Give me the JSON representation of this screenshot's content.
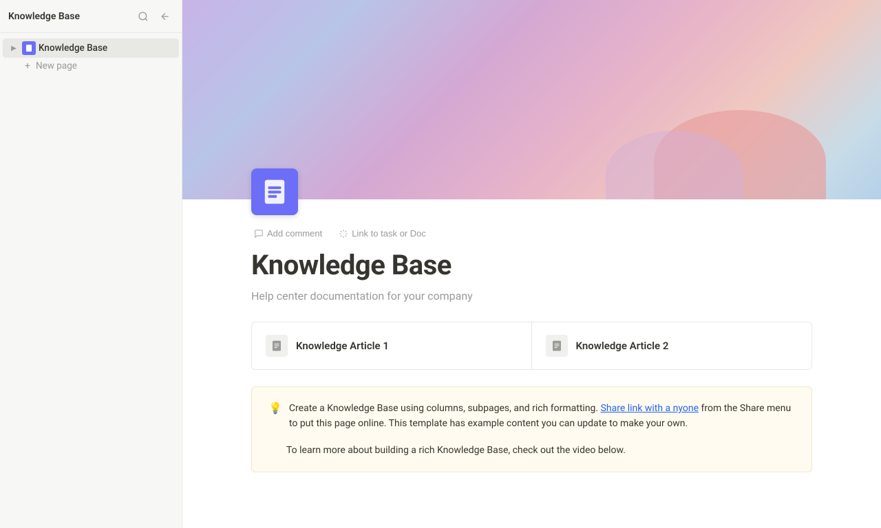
{
  "sidebar": {
    "title": "Knowledge Base",
    "search_tooltip": "Search",
    "collapse_tooltip": "Collapse sidebar",
    "nav_items": [
      {
        "id": "knowledge-base",
        "label": "Knowledge Base",
        "active": true
      }
    ],
    "new_page_label": "New page"
  },
  "hero": {
    "alt": "Colorful gradient banner"
  },
  "page": {
    "icon_alt": "Document icon",
    "toolbar": {
      "add_comment": "Add comment",
      "link_to_task": "Link to task or Doc"
    },
    "title": "Knowledge Base",
    "description": "Help center documentation for your company"
  },
  "articles": [
    {
      "label": "Knowledge Article 1"
    },
    {
      "label": "Knowledge Article 2"
    }
  ],
  "info_box": {
    "text1_before_link": "Create a Knowledge Base using columns, subpages, and rich formatting. ",
    "link_text": "Share link with a nyone",
    "text1_after_link": " from the Share menu to put this page online. This template has example content you can update to make your own.",
    "text2": "To learn more about building a rich Knowledge Base, check out the video below."
  }
}
